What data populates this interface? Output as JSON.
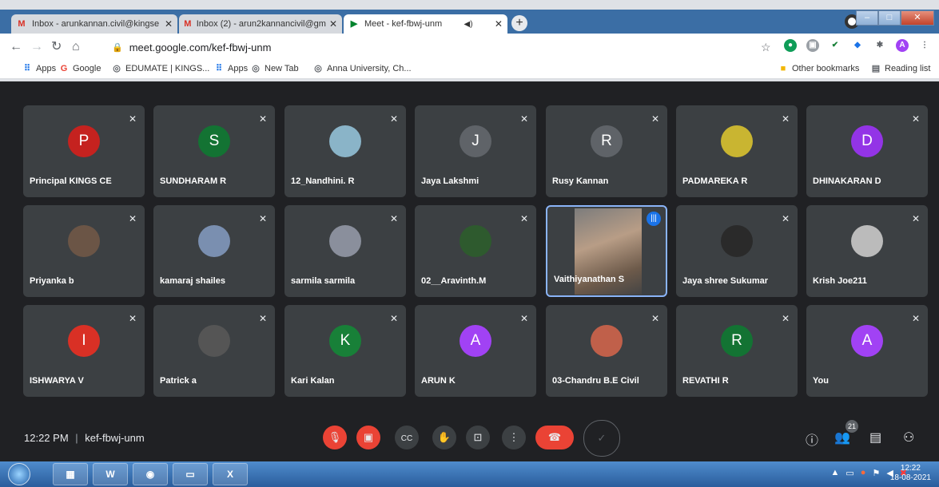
{
  "browser": {
    "tabs": [
      {
        "title": "Inbox - arunkannan.civil@kingse",
        "icon": "gmail-icon"
      },
      {
        "title": "Inbox (2) - arun2kannancivil@gm",
        "icon": "gmail-icon"
      },
      {
        "title": "Meet - kef-fbwj-unm",
        "icon": "meet-icon",
        "active": true
      }
    ],
    "url": "meet.google.com/kef-fbwj-unm",
    "bookmarks": [
      "Apps",
      "Google",
      "EDUMATE | KINGS...",
      "Apps",
      "New Tab",
      "Anna University, Ch..."
    ],
    "other_bookmarks": "Other bookmarks",
    "reading_list": "Reading list",
    "profile_initial": "A"
  },
  "participants": [
    {
      "name": "Principal KINGS CE",
      "initial": "P",
      "color": "#c5221f"
    },
    {
      "name": "SUNDHARAM R",
      "initial": "S",
      "color": "#137333"
    },
    {
      "name": "12_Nandhini. R",
      "initial": "",
      "color": "#8ab4c8"
    },
    {
      "name": "Jaya Lakshmi",
      "initial": "J",
      "color": "#5f6368"
    },
    {
      "name": "Rusy Kannan",
      "initial": "R",
      "color": "#5f6368"
    },
    {
      "name": "PADMAREKA R",
      "initial": "",
      "color": "#c9b531"
    },
    {
      "name": "DHINAKARAN D",
      "initial": "D",
      "color": "#9334e6"
    },
    {
      "name": "Priyanka b",
      "initial": "",
      "color": "#6b5546"
    },
    {
      "name": "kamaraj shailes",
      "initial": "",
      "color": "#7a8fb0"
    },
    {
      "name": "sarmila sarmila",
      "initial": "",
      "color": "#8a8f9c"
    },
    {
      "name": "02__Aravinth.M",
      "initial": "",
      "color": "#2e5a2e"
    },
    {
      "name": "Vaithiyanathan S",
      "initial": "",
      "color": "#9a8070",
      "speaking": true
    },
    {
      "name": "Jaya shree Sukumar",
      "initial": "",
      "color": "#2a2a2a"
    },
    {
      "name": "Krish Joe211",
      "initial": "",
      "color": "#bbbbbb"
    },
    {
      "name": "ISHWARYA V",
      "initial": "I",
      "color": "#d93025"
    },
    {
      "name": "Patrick a",
      "initial": "",
      "color": "#555555"
    },
    {
      "name": "Kari Kalan",
      "initial": "K",
      "color": "#188038"
    },
    {
      "name": "ARUN K",
      "initial": "A",
      "color": "#a142f4"
    },
    {
      "name": "03-Chandru B.E Civil",
      "initial": "",
      "color": "#c0604a"
    },
    {
      "name": "REVATHI R",
      "initial": "R",
      "color": "#137333"
    },
    {
      "name": "You",
      "initial": "A",
      "color": "#a142f4"
    }
  ],
  "meeting": {
    "time": "12:22 PM",
    "separator": "|",
    "code": "kef-fbwj-unm",
    "participant_count": "21"
  },
  "taskbar": {
    "clock_time": "12:22",
    "clock_date": "18-08-2021"
  }
}
